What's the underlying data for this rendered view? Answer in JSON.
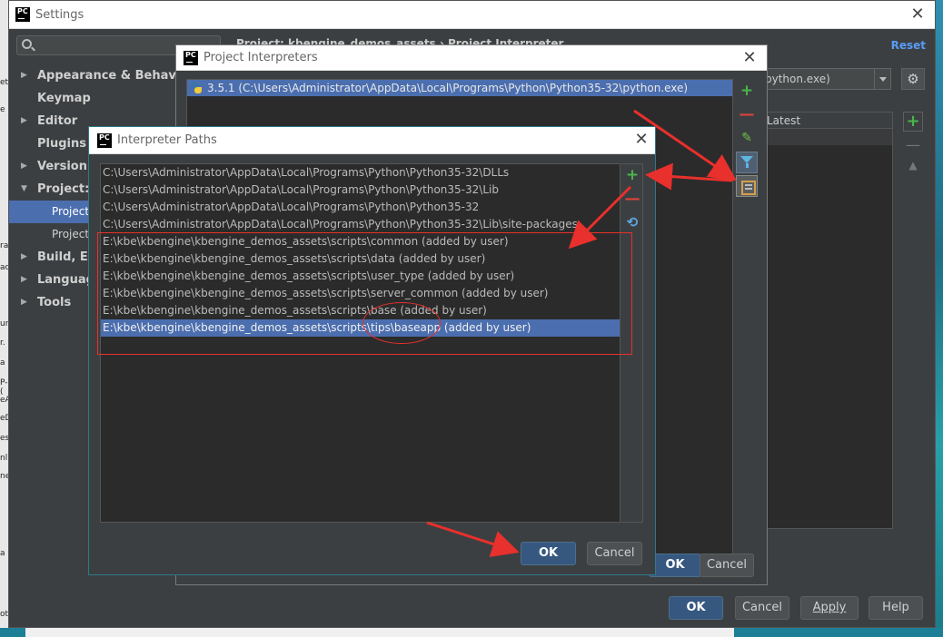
{
  "desktop": {
    "left_fragments": [
      "et",
      "e",
      "ra",
      "ac",
      "un",
      "r.",
      "a",
      "P-(",
      "eA",
      "eD",
      "es",
      "nl",
      "ne",
      "a",
      "ot"
    ]
  },
  "settings": {
    "title": "Settings",
    "search_placeholder": "",
    "tree": [
      {
        "label": "Appearance & Behavior",
        "arrow": "▶",
        "bold": true
      },
      {
        "label": "Keymap",
        "arrow": "",
        "bold": true
      },
      {
        "label": "Editor",
        "arrow": "▶",
        "bold": true
      },
      {
        "label": "Plugins",
        "arrow": "",
        "bold": true
      },
      {
        "label": "Version C",
        "arrow": "▶",
        "bold": true
      },
      {
        "label": "Project: k",
        "arrow": "▼",
        "bold": true
      },
      {
        "label": "Project",
        "arrow": "",
        "bold": false,
        "sub": true,
        "selected": true
      },
      {
        "label": "Project",
        "arrow": "",
        "bold": false,
        "sub": true
      },
      {
        "label": "Build, Exe",
        "arrow": "▶",
        "bold": true
      },
      {
        "label": "Language",
        "arrow": "▶",
        "bold": true
      },
      {
        "label": "Tools",
        "arrow": "▶",
        "bold": true
      }
    ],
    "header": "Project: kbengine_demos_assets › Project Interpreter",
    "reset_label": "Reset",
    "interpreter_combo_value": "python.exe)",
    "gear_glyph": "⚙",
    "package_column": "Latest",
    "add_glyph": "+",
    "minus_glyph": "—",
    "up_glyph": "▲",
    "buttons": {
      "ok": "OK",
      "cancel": "Cancel",
      "apply": "Apply",
      "help": "Help"
    }
  },
  "project_interpreters": {
    "title": "Project Interpreters",
    "selected_interpreter": "3.5.1 (C:\\Users\\Administrator\\AppData\\Local\\Programs\\Python\\Python35-32\\python.exe)",
    "tool_glyphs": {
      "add": "+",
      "remove": "—",
      "edit": "✎"
    },
    "buttons": {
      "ok": "OK",
      "cancel": "Cancel"
    }
  },
  "interpreter_paths": {
    "title": "Interpreter Paths",
    "paths": [
      "C:\\Users\\Administrator\\AppData\\Local\\Programs\\Python\\Python35-32\\DLLs",
      "C:\\Users\\Administrator\\AppData\\Local\\Programs\\Python\\Python35-32\\Lib",
      "C:\\Users\\Administrator\\AppData\\Local\\Programs\\Python\\Python35-32",
      "C:\\Users\\Administrator\\AppData\\Local\\Programs\\Python\\Python35-32\\Lib\\site-packages",
      "E:\\kbe\\kbengine\\kbengine_demos_assets\\scripts\\common  (added by user)",
      "E:\\kbe\\kbengine\\kbengine_demos_assets\\scripts\\data  (added by user)",
      "E:\\kbe\\kbengine\\kbengine_demos_assets\\scripts\\user_type  (added by user)",
      "E:\\kbe\\kbengine\\kbengine_demos_assets\\scripts\\server_common  (added by user)",
      "E:\\kbe\\kbengine\\kbengine_demos_assets\\scripts\\base  (added by user)",
      "E:\\kbe\\kbengine\\kbengine_demos_assets\\scripts\\tips\\baseapp  (added by user)"
    ],
    "selected_index": 9,
    "tool_glyphs": {
      "add": "+",
      "remove": "—",
      "refresh": "⟲"
    },
    "buttons": {
      "ok": "OK",
      "cancel": "Cancel"
    }
  },
  "colors": {
    "dark_bg": "#3c3f41",
    "list_bg": "#2b2b2b",
    "selection": "#4b6eaf",
    "annotation_red": "#e8302c",
    "link_blue": "#589df6"
  }
}
